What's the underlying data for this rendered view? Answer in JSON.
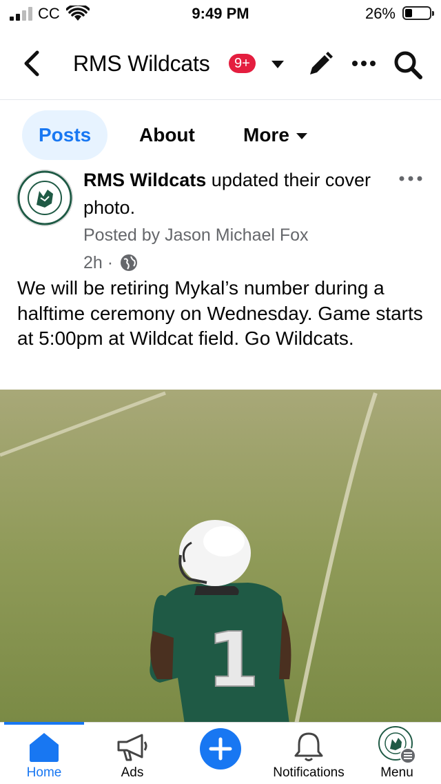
{
  "status_bar": {
    "carrier": "CC",
    "time": "9:49 PM",
    "battery": "26%"
  },
  "header": {
    "title": "RMS Wildcats",
    "badge": "9+"
  },
  "tabs": [
    {
      "label": "Posts"
    },
    {
      "label": "About"
    },
    {
      "label": "More"
    }
  ],
  "post": {
    "page_name": "RMS Wildcats",
    "action": " updated their cover photo.",
    "posted_by": "Posted by Jason Michael Fox",
    "time": "2h ·",
    "text": "We will be retiring Mykal’s number during a halftime ceremony on Wednesday.  Game starts at 5:00pm at Wildcat field.  Go Wildcats.",
    "jersey_number": "1"
  },
  "bottom_nav": [
    {
      "label": "Home"
    },
    {
      "label": "Ads"
    },
    {
      "label": "Notifications"
    },
    {
      "label": "Menu"
    }
  ],
  "colors": {
    "accent": "#1877f2",
    "badge": "#e41e3f",
    "jersey": "#1f5a45"
  }
}
